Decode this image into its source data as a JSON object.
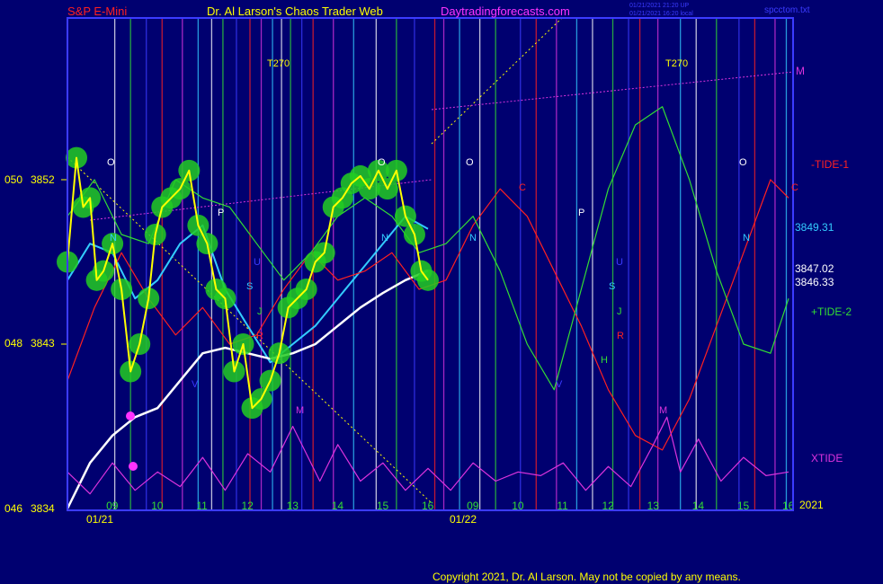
{
  "header": {
    "symbol": "S&P E-Mini",
    "site_title": "Dr. Al Larson's Chaos Trader Web",
    "site_url": "Daytradingforecasts.com",
    "timestamp_1": "01/21/2021 21:20 UP",
    "timestamp_2": "01/21/2021 16:20 local",
    "file_name": "spcctom.txt"
  },
  "copyright": "Copyright 2021, Dr. Al Larson. May not be copied by any means.",
  "colors": {
    "background": "#000070",
    "frame": "#3b3bff",
    "price_yellow": "#ffff00",
    "ma_cyan": "#33ccff",
    "ma_white": "#ffffff",
    "tide1_red": "#ff2020",
    "tide2_green": "#33dd33",
    "xtide_magenta": "#dd33dd",
    "bubble_green": "#22cc22"
  },
  "chart_data": {
    "type": "line",
    "title": "S&P E-Mini",
    "y_left_ticks": [
      {
        "label": "050",
        "value": 3852
      },
      {
        "label": "048",
        "value": 3843
      },
      {
        "label": "046",
        "value": 3834
      }
    ],
    "y_prices": [
      {
        "label": "3852",
        "value": 3852
      },
      {
        "label": "3843",
        "value": 3843
      },
      {
        "label": "3834",
        "value": 3834
      }
    ],
    "ylim": [
      3834,
      3852
    ],
    "x_hours": [
      {
        "label": "09",
        "x": 9
      },
      {
        "label": "10",
        "x": 10
      },
      {
        "label": "11",
        "x": 11
      },
      {
        "label": "12",
        "x": 12
      },
      {
        "label": "13",
        "x": 13
      },
      {
        "label": "14",
        "x": 14
      },
      {
        "label": "15",
        "x": 15
      },
      {
        "label": "16",
        "x": 16
      },
      {
        "label": "09",
        "x": 17
      },
      {
        "label": "10",
        "x": 18
      },
      {
        "label": "11",
        "x": 19
      },
      {
        "label": "12",
        "x": 20
      },
      {
        "label": "13",
        "x": 21
      },
      {
        "label": "14",
        "x": 22
      },
      {
        "label": "15",
        "x": 23
      },
      {
        "label": "16",
        "x": 24
      }
    ],
    "xlim": [
      8.0,
      24.1
    ],
    "date_labels": [
      {
        "label": "01/21",
        "x": 8.5
      },
      {
        "label": "01/22",
        "x": 16.6
      }
    ],
    "year_label": "2021",
    "right_labels": [
      {
        "label": "-TIDE-1",
        "color": "#ff2020"
      },
      {
        "label": "3849.31",
        "color": "#33ccff"
      },
      {
        "label": "3847.02",
        "color": "#ffffff"
      },
      {
        "label": "3846.33",
        "color": "#ffffff"
      },
      {
        "label": "+TIDE-2",
        "color": "#33dd33"
      },
      {
        "label": "XTIDE",
        "color": "#dd33dd"
      },
      {
        "label": "M",
        "color": "#dd33dd"
      }
    ],
    "markers": [
      "O",
      "P",
      "N",
      "U",
      "S",
      "J",
      "R",
      "H",
      "M",
      "V",
      "C",
      "T270"
    ],
    "series": [
      {
        "name": "price",
        "color": "#ffff00",
        "x": [
          8.0,
          8.2,
          8.35,
          8.5,
          8.65,
          8.8,
          9.0,
          9.2,
          9.4,
          9.6,
          9.8,
          9.95,
          10.1,
          10.3,
          10.5,
          10.7,
          10.9,
          11.1,
          11.3,
          11.5,
          11.7,
          11.9,
          12.1,
          12.3,
          12.5,
          12.7,
          12.9,
          13.1,
          13.3,
          13.5,
          13.7,
          13.9,
          14.1,
          14.3,
          14.5,
          14.7,
          14.9,
          15.1,
          15.3,
          15.5,
          15.7,
          15.85,
          16.0
        ],
        "values": [
          3847.5,
          3853.2,
          3850.5,
          3851,
          3846.5,
          3847,
          3848.5,
          3846,
          3841.5,
          3843,
          3845.5,
          3849,
          3850.5,
          3851,
          3851.5,
          3852.5,
          3849.5,
          3848.5,
          3846,
          3845.5,
          3841.5,
          3843,
          3839.5,
          3840,
          3841,
          3842.5,
          3845,
          3845.5,
          3846,
          3847.5,
          3848,
          3850.5,
          3851,
          3851.8,
          3852.2,
          3851.5,
          3852.5,
          3851.5,
          3852.5,
          3850,
          3849,
          3847,
          3846.5
        ]
      },
      {
        "name": "3849.31",
        "color": "#33ccff",
        "x": [
          8.0,
          8.5,
          9.0,
          9.5,
          10.0,
          10.5,
          11.0,
          11.5,
          12.0,
          12.5,
          13.0,
          13.5,
          14.0,
          14.5,
          15.0,
          15.5,
          16.0
        ],
        "values": [
          3846.5,
          3848.5,
          3848,
          3845.5,
          3846.5,
          3848.5,
          3849.5,
          3846,
          3844,
          3842,
          3843,
          3844,
          3845.5,
          3847,
          3848.5,
          3850,
          3849.31
        ]
      },
      {
        "name": "3847.02",
        "color": "#ffffff",
        "x": [
          8.0,
          8.5,
          9.0,
          9.5,
          10.0,
          10.5,
          11.0,
          11.5,
          12.0,
          12.5,
          13.0,
          13.5,
          14.0,
          14.5,
          15.0,
          15.5,
          16.0
        ],
        "values": [
          3834,
          3836.5,
          3838,
          3839,
          3839.5,
          3841,
          3842.5,
          3842.8,
          3842.5,
          3842.2,
          3842.5,
          3843,
          3844,
          3845,
          3845.8,
          3846.5,
          3847.02
        ]
      },
      {
        "name": "-TIDE-1",
        "color": "#ff2020",
        "x": [
          8.0,
          8.6,
          9.2,
          9.8,
          10.4,
          11.0,
          11.6,
          12.2,
          12.8,
          13.4,
          14.0,
          14.6,
          15.2,
          15.8,
          16.4,
          17.0,
          17.6,
          18.2,
          18.8,
          19.4,
          20.0,
          20.6,
          21.2,
          21.8,
          22.4,
          23.0,
          23.6,
          24.0
        ],
        "values": [
          3841,
          3845,
          3848,
          3845.5,
          3843.5,
          3845,
          3843,
          3843.5,
          3846,
          3848,
          3846.5,
          3847,
          3848,
          3846,
          3846.5,
          3849.5,
          3851.5,
          3850,
          3847,
          3844,
          3840.5,
          3838,
          3837.2,
          3840,
          3844,
          3848,
          3852,
          3851
        ]
      },
      {
        "name": "+TIDE-2",
        "color": "#33dd33",
        "x": [
          8.0,
          8.6,
          9.2,
          9.8,
          10.4,
          11.0,
          11.6,
          12.2,
          12.8,
          13.4,
          14.0,
          14.6,
          15.2,
          15.8,
          16.4,
          17.0,
          17.6,
          18.2,
          18.8,
          19.4,
          20.0,
          20.6,
          21.2,
          21.8,
          22.4,
          23.0,
          23.6,
          24.0
        ],
        "values": [
          3850,
          3852,
          3849,
          3848.5,
          3852,
          3851,
          3850.5,
          3848.5,
          3846.5,
          3848,
          3850,
          3851,
          3850,
          3848,
          3848.5,
          3850,
          3847,
          3843,
          3840.5,
          3846,
          3851.5,
          3855,
          3856,
          3852,
          3847,
          3843,
          3842.5,
          3845.5
        ]
      },
      {
        "name": "XTIDE",
        "color": "#dd33dd",
        "x": [
          8.0,
          8.5,
          9.0,
          9.5,
          10.0,
          10.5,
          11.0,
          11.5,
          12.0,
          12.5,
          13.0,
          13.3,
          13.6,
          14.0,
          14.5,
          15.0,
          15.5,
          16.0,
          16.5,
          17.0,
          17.5,
          18.0,
          18.5,
          19.0,
          19.5,
          20.0,
          20.5,
          21.0,
          21.3,
          21.6,
          22.0,
          22.5,
          23.0,
          23.5,
          24.0
        ],
        "values": [
          3836,
          3834.8,
          3836.5,
          3835,
          3836,
          3835.2,
          3836.8,
          3835,
          3837,
          3836,
          3838.5,
          3837,
          3835.5,
          3837.5,
          3835.5,
          3836.5,
          3835,
          3836.2,
          3835,
          3836.5,
          3835.5,
          3836,
          3835.8,
          3836.5,
          3835,
          3836.3,
          3835.2,
          3837.5,
          3839,
          3836,
          3837.8,
          3835.5,
          3836.8,
          3835.8,
          3836
        ]
      }
    ],
    "grid": false,
    "legend": "right"
  }
}
